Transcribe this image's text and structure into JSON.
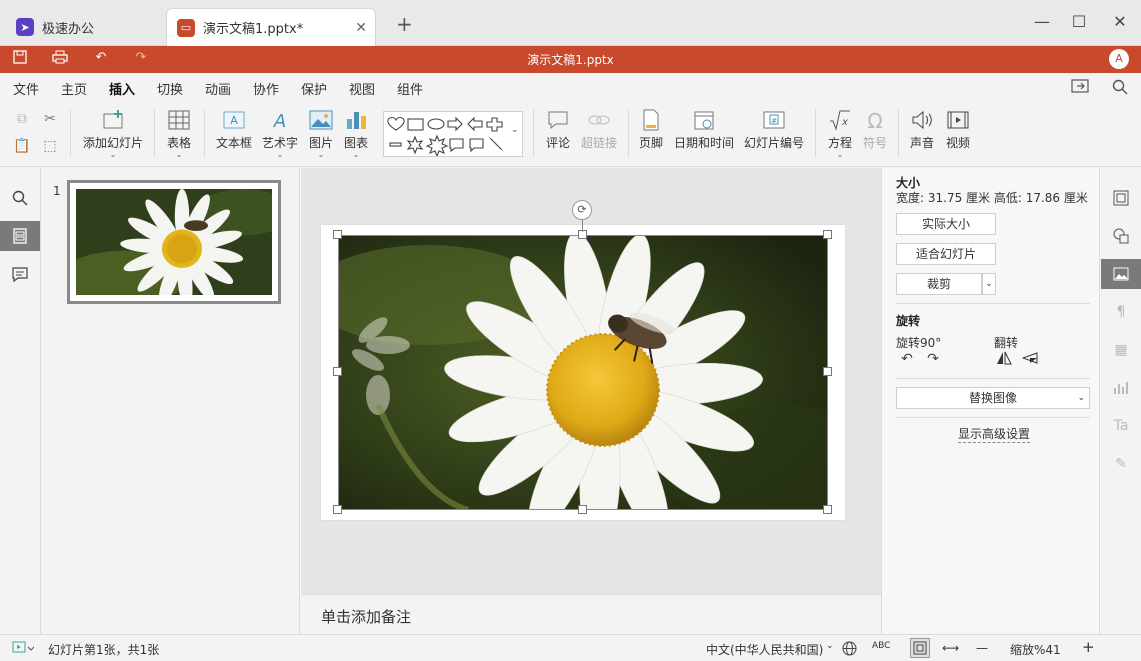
{
  "tabs": {
    "home_label": "极速办公",
    "doc_label": "演示文稿1.pptx*",
    "new_tab": "+",
    "close": "✕"
  },
  "window": {
    "minimize": "—",
    "maximize": "☐",
    "close": "✕"
  },
  "titlebar": {
    "title": "演示文稿1.pptx",
    "avatar": "A"
  },
  "menu": {
    "items": [
      "文件",
      "主页",
      "插入",
      "切换",
      "动画",
      "协作",
      "保护",
      "视图",
      "组件"
    ],
    "active": "插入"
  },
  "ribbon": {
    "add_slide": "添加幻灯片",
    "table": "表格",
    "textbox": "文本框",
    "wordart": "艺术字",
    "picture": "图片",
    "chart": "图表",
    "comment": "评论",
    "hyperlink": "超链接",
    "footer": "页脚",
    "datetime": "日期和时间",
    "slide_number": "幻灯片编号",
    "equation": "方程",
    "symbol": "符号",
    "audio": "声音",
    "video": "视频"
  },
  "slides": {
    "number": "1"
  },
  "notes": {
    "placeholder": "单击添加备注"
  },
  "props": {
    "size_title": "大小",
    "size_text": "宽度: 31.75 厘米   高低: 17.86 厘米",
    "actual_size": "实际大小",
    "fit_slide": "适合幻灯片",
    "crop": "裁剪",
    "rotate_title": "旋转",
    "rotate90": "旋转90°",
    "flip": "翻转",
    "replace_image": "替换图像",
    "advanced": "显示高级设置"
  },
  "status": {
    "slide_info": "幻灯片第1张，共1张",
    "language": "中文(中华人民共和国)",
    "zoom": "缩放%41",
    "spell": "ABC"
  },
  "colors": {
    "accent": "#c8492c",
    "active_panel": "#7a7a7a"
  }
}
